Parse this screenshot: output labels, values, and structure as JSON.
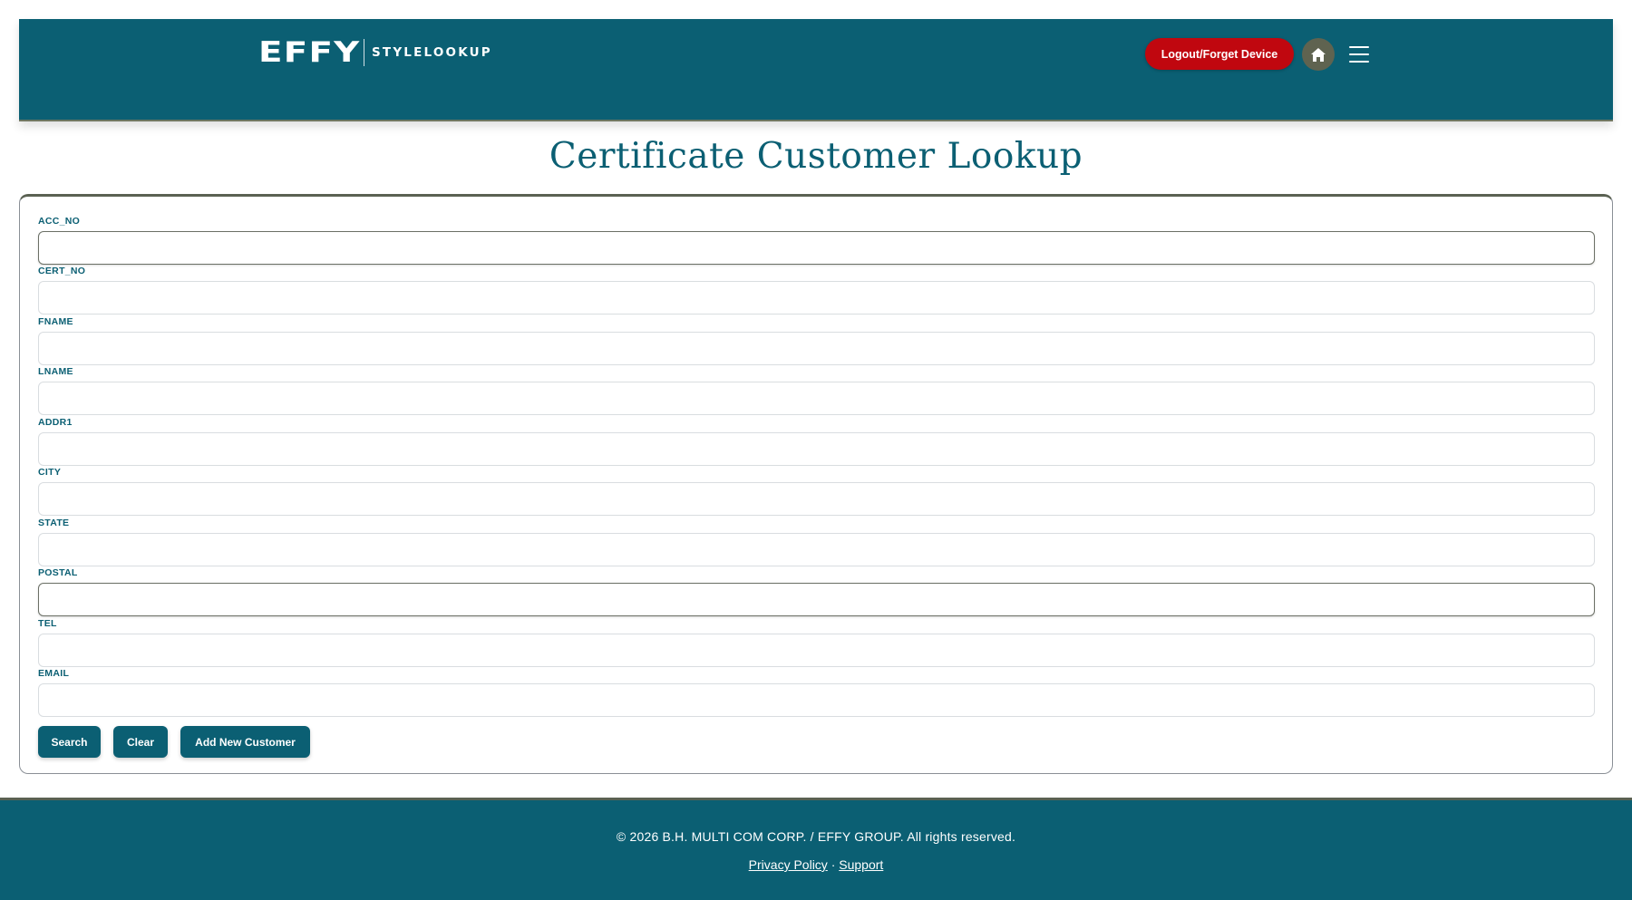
{
  "header": {
    "logo_mark": "EFFY",
    "logo_text": "STYLELOOKUP",
    "logout_label": "Logout/Forget Device",
    "home_icon": "home-icon",
    "menu_icon": "hamburger-menu-icon",
    "colors": {
      "background": "#0b5f73",
      "logout": "#c0070f",
      "home": "#5f6350"
    }
  },
  "page": {
    "title": "Certificate Customer Lookup"
  },
  "form": {
    "fields": [
      {
        "label": "ACC_NO",
        "value": "",
        "placeholder": ""
      },
      {
        "label": "CERT_NO",
        "value": "",
        "placeholder": ""
      },
      {
        "label": "FNAME",
        "value": "",
        "placeholder": ""
      },
      {
        "label": "LNAME",
        "value": "",
        "placeholder": ""
      },
      {
        "label": "ADDR1",
        "value": "",
        "placeholder": ""
      },
      {
        "label": "CITY",
        "value": "",
        "placeholder": ""
      },
      {
        "label": "STATE",
        "value": "",
        "placeholder": ""
      },
      {
        "label": "POSTAL",
        "value": "",
        "placeholder": ""
      },
      {
        "label": "TEL",
        "value": "",
        "placeholder": ""
      },
      {
        "label": "EMAIL",
        "value": "",
        "placeholder": ""
      }
    ],
    "buttons": {
      "search": "Search",
      "clear": "Clear",
      "add_new": "Add New Customer"
    }
  },
  "footer": {
    "copyright": "© 2026 B.H. MULTI COM CORP. / EFFY GROUP. All rights reserved.",
    "privacy": "Privacy Policy",
    "separator": "·",
    "support": "Support"
  }
}
